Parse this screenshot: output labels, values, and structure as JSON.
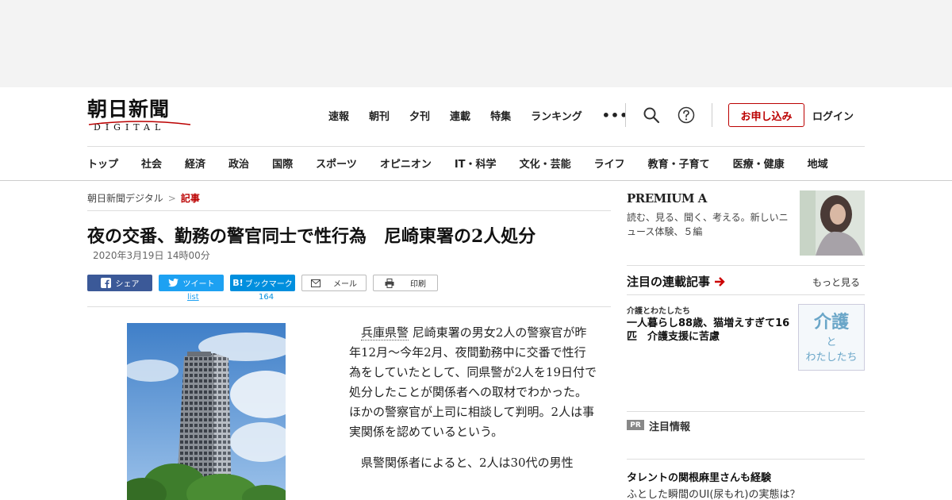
{
  "header": {
    "logo_main": "朝日新聞",
    "logo_sub": "DIGITAL",
    "top_nav": [
      "速報",
      "朝刊",
      "夕刊",
      "連載",
      "特集",
      "ランキング"
    ],
    "more_glyph": "•••",
    "apply_label": "お申し込み",
    "login_label": "ログイン",
    "categories": [
      "トップ",
      "社会",
      "経済",
      "政治",
      "国際",
      "スポーツ",
      "オピニオン",
      "IT・科学",
      "文化・芸能",
      "ライフ",
      "教育・子育て",
      "医療・健康",
      "地域"
    ]
  },
  "breadcrumb": {
    "home": "朝日新聞デジタル",
    "separator": ">",
    "current": "記事"
  },
  "article": {
    "headline": "夜の交番、勤務の警官同士で性行為　尼崎東署の2人処分",
    "date": "2020年3月19日 14時00分",
    "paragraph1_link": "兵庫県警",
    "paragraph1_rest": "尼崎東署の男女2人の警察官が昨年12月～今年2月、夜間勤務中に交番で性行為をしていたとして、同県警が2人を19日付で処分したことが関係者への取材でわかった。ほかの警察官が上司に相談して判明。2人は事実関係を認めているという。",
    "paragraph2": "県警関係者によると、2人は30代の男性"
  },
  "share": {
    "facebook_label": "シェア",
    "twitter_label": "ツイート",
    "twitter_count": "list",
    "hatena_label": "ブックマーク",
    "hatena_glyph": "B!",
    "hatena_count": "164",
    "mail_label": "メール",
    "print_label": "印刷"
  },
  "sidebar": {
    "premium_title": "PREMIUM A",
    "premium_desc": "読む、見る、聞く、考える。新しいニュース体験、５編",
    "series_title": "注目の連載記事",
    "more_label": "もっと見る",
    "series_category": "介護とわたしたち",
    "series_headline": "一人暮らし88歳、猫増えすぎて16匹　介護支援に苦慮",
    "kaigo_line1": "介護",
    "kaigo_line2": "と",
    "kaigo_line3": "わたしたち",
    "pr_badge": "PR",
    "pr_label": "注目情報",
    "pr_headline": "タレントの関根麻里さんも経験",
    "pr_sub": "ふとした瞬間のUI(尿もれ)の実態は？"
  },
  "colors": {
    "accent_red": "#bb0000",
    "facebook": "#3b5998",
    "twitter": "#1da1f2",
    "hatena": "#008fde"
  }
}
